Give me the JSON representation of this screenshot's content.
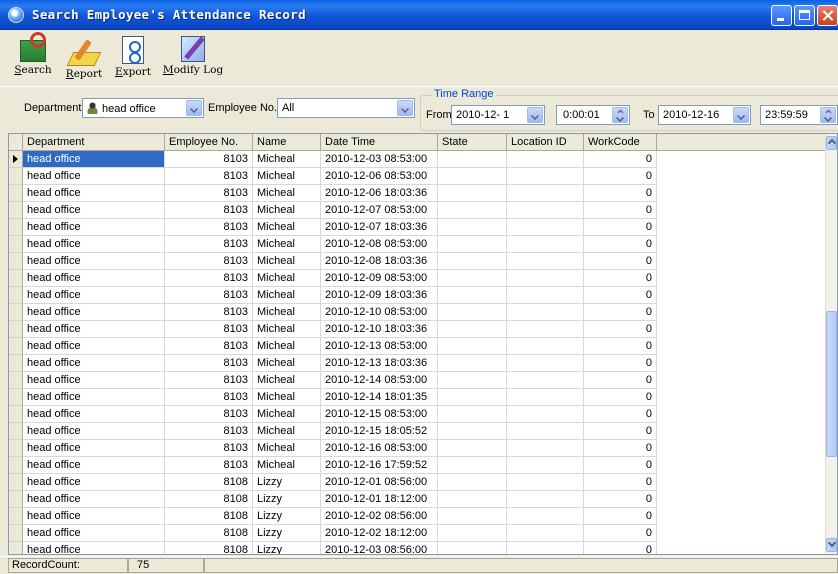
{
  "window": {
    "title": "Search Employee's Attendance Record"
  },
  "toolbar": [
    {
      "key": "S",
      "rest": "earch",
      "icon": "search-icon"
    },
    {
      "key": "R",
      "rest": "eport",
      "icon": "report-icon"
    },
    {
      "key": "E",
      "rest": "xport",
      "icon": "export-icon"
    },
    {
      "key": "M",
      "rest": "odify Log",
      "icon": "modify-log-icon"
    }
  ],
  "filters": {
    "department_label": "Department",
    "department_value": "head office",
    "employee_label": "Employee No.",
    "employee_value": "All",
    "time_range_title": "Time Range",
    "from_label": "From",
    "from_date": "2010-12- 1",
    "from_time": "0:00:01",
    "to_label": "To",
    "to_date": "2010-12-16",
    "to_time": "23:59:59"
  },
  "grid": {
    "columns": [
      "Department",
      "Employee No.",
      "Name",
      "Date Time",
      "State",
      "Location ID",
      "WorkCode"
    ],
    "rows": [
      [
        "head office",
        "8103",
        "Micheal",
        "2010-12-03 08:53:00",
        "",
        "",
        "0"
      ],
      [
        "head office",
        "8103",
        "Micheal",
        "2010-12-06 08:53:00",
        "",
        "",
        "0"
      ],
      [
        "head office",
        "8103",
        "Micheal",
        "2010-12-06 18:03:36",
        "",
        "",
        "0"
      ],
      [
        "head office",
        "8103",
        "Micheal",
        "2010-12-07 08:53:00",
        "",
        "",
        "0"
      ],
      [
        "head office",
        "8103",
        "Micheal",
        "2010-12-07 18:03:36",
        "",
        "",
        "0"
      ],
      [
        "head office",
        "8103",
        "Micheal",
        "2010-12-08 08:53:00",
        "",
        "",
        "0"
      ],
      [
        "head office",
        "8103",
        "Micheal",
        "2010-12-08 18:03:36",
        "",
        "",
        "0"
      ],
      [
        "head office",
        "8103",
        "Micheal",
        "2010-12-09 08:53:00",
        "",
        "",
        "0"
      ],
      [
        "head office",
        "8103",
        "Micheal",
        "2010-12-09 18:03:36",
        "",
        "",
        "0"
      ],
      [
        "head office",
        "8103",
        "Micheal",
        "2010-12-10 08:53:00",
        "",
        "",
        "0"
      ],
      [
        "head office",
        "8103",
        "Micheal",
        "2010-12-10 18:03:36",
        "",
        "",
        "0"
      ],
      [
        "head office",
        "8103",
        "Micheal",
        "2010-12-13 08:53:00",
        "",
        "",
        "0"
      ],
      [
        "head office",
        "8103",
        "Micheal",
        "2010-12-13 18:03:36",
        "",
        "",
        "0"
      ],
      [
        "head office",
        "8103",
        "Micheal",
        "2010-12-14 08:53:00",
        "",
        "",
        "0"
      ],
      [
        "head office",
        "8103",
        "Micheal",
        "2010-12-14 18:01:35",
        "",
        "",
        "0"
      ],
      [
        "head office",
        "8103",
        "Micheal",
        "2010-12-15 08:53:00",
        "",
        "",
        "0"
      ],
      [
        "head office",
        "8103",
        "Micheal",
        "2010-12-15 18:05:52",
        "",
        "",
        "0"
      ],
      [
        "head office",
        "8103",
        "Micheal",
        "2010-12-16 08:53:00",
        "",
        "",
        "0"
      ],
      [
        "head office",
        "8103",
        "Micheal",
        "2010-12-16 17:59:52",
        "",
        "",
        "0"
      ],
      [
        "head office",
        "8108",
        "Lizzy",
        "2010-12-01 08:56:00",
        "",
        "",
        "0"
      ],
      [
        "head office",
        "8108",
        "Lizzy",
        "2010-12-01 18:12:00",
        "",
        "",
        "0"
      ],
      [
        "head office",
        "8108",
        "Lizzy",
        "2010-12-02 08:56:00",
        "",
        "",
        "0"
      ],
      [
        "head office",
        "8108",
        "Lizzy",
        "2010-12-02 18:12:00",
        "",
        "",
        "0"
      ],
      [
        "head office",
        "8108",
        "Lizzy",
        "2010-12-03 08:56:00",
        "",
        "",
        "0"
      ]
    ],
    "selected_row": 0
  },
  "status": {
    "label": "RecordCount:",
    "value": "75"
  }
}
